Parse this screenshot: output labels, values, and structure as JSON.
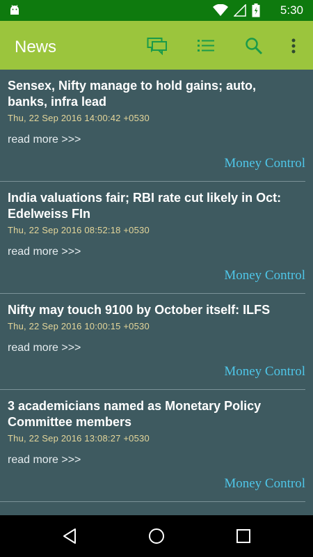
{
  "status_bar": {
    "time": "5:30",
    "icons": [
      "android-icon",
      "wifi-icon",
      "signal-icon",
      "battery-icon"
    ]
  },
  "app_bar": {
    "title": "News",
    "actions": [
      "chat-icon",
      "list-icon",
      "search-icon",
      "more-vert-icon"
    ]
  },
  "colors": {
    "status_bar": "#0e7a0e",
    "app_bar": "#9bc53d",
    "background": "#3e5a60",
    "date": "#e4d69a",
    "source": "#4fc6e8"
  },
  "news": [
    {
      "title": "Sensex, Nifty manage to hold gains; auto, banks, infra lead",
      "date": "Thu, 22 Sep 2016 14:00:42 +0530",
      "read_more": "read more >>>",
      "source": "Money Control"
    },
    {
      "title": "India valuations fair; RBI rate cut likely in Oct: Edelweiss FIn",
      "date": "Thu, 22 Sep 2016 08:52:18 +0530",
      "read_more": "read more >>>",
      "source": "Money Control"
    },
    {
      "title": "Nifty may touch 9100 by October itself: ILFS",
      "date": "Thu, 22 Sep 2016 10:00:15 +0530",
      "read_more": "read more >>>",
      "source": "Money Control"
    },
    {
      "title": "3 academicians named as Monetary Policy Committee members",
      "date": "Thu, 22 Sep 2016 13:08:27 +0530",
      "read_more": "read more >>>",
      "source": "Money Control"
    }
  ],
  "nav_bar": [
    "back-icon",
    "home-icon",
    "recents-icon"
  ]
}
